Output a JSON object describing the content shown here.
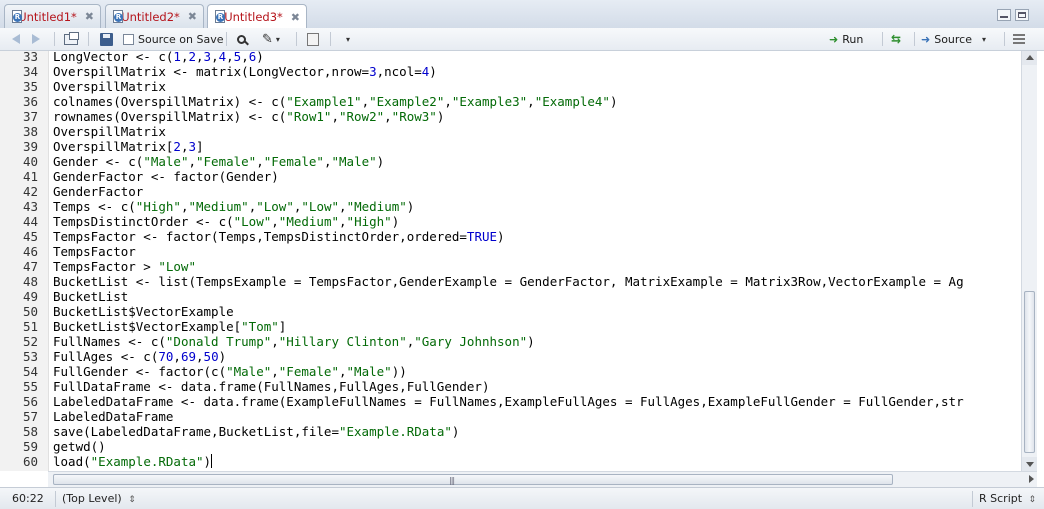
{
  "tabs": [
    {
      "label": "Untitled1*",
      "active": false
    },
    {
      "label": "Untitled2*",
      "active": false
    },
    {
      "label": "Untitled3*",
      "active": true
    }
  ],
  "toolbar": {
    "source_on_save_label": "Source on Save",
    "run_label": "Run",
    "source_label": "Source"
  },
  "code_lines": [
    {
      "n": "33",
      "text": "LongVector <- c(1,2,3,4,5,6)"
    },
    {
      "n": "34",
      "text": "OverspillMatrix <- matrix(LongVector,nrow=3,ncol=4)"
    },
    {
      "n": "35",
      "text": "OverspillMatrix"
    },
    {
      "n": "36",
      "text": "colnames(OverspillMatrix) <- c(\"Example1\",\"Example2\",\"Example3\",\"Example4\")"
    },
    {
      "n": "37",
      "text": "rownames(OverspillMatrix) <- c(\"Row1\",\"Row2\",\"Row3\")"
    },
    {
      "n": "38",
      "text": "OverspillMatrix"
    },
    {
      "n": "39",
      "text": "OverspillMatrix[2,3]"
    },
    {
      "n": "40",
      "text": "Gender <- c(\"Male\",\"Female\",\"Female\",\"Male\")"
    },
    {
      "n": "41",
      "text": "GenderFactor <- factor(Gender)"
    },
    {
      "n": "42",
      "text": "GenderFactor"
    },
    {
      "n": "43",
      "text": "Temps <- c(\"High\",\"Medium\",\"Low\",\"Low\",\"Medium\")"
    },
    {
      "n": "44",
      "text": "TempsDistinctOrder <- c(\"Low\",\"Medium\",\"High\")"
    },
    {
      "n": "45",
      "text": "TempsFactor <- factor(Temps,TempsDistinctOrder,ordered=TRUE)"
    },
    {
      "n": "46",
      "text": "TempsFactor"
    },
    {
      "n": "47",
      "text": "TempsFactor > \"Low\""
    },
    {
      "n": "48",
      "text": "BucketList <- list(TempsExample = TempsFactor,GenderExample = GenderFactor, MatrixExample = Matrix3Row,VectorExample = Ag"
    },
    {
      "n": "49",
      "text": "BucketList"
    },
    {
      "n": "50",
      "text": "BucketList$VectorExample"
    },
    {
      "n": "51",
      "text": "BucketList$VectorExample[\"Tom\"]"
    },
    {
      "n": "52",
      "text": "FullNames <- c(\"Donald Trump\",\"Hillary Clinton\",\"Gary Johnhson\")"
    },
    {
      "n": "53",
      "text": "FullAges <- c(70,69,50)"
    },
    {
      "n": "54",
      "text": "FullGender <- factor(c(\"Male\",\"Female\",\"Male\"))"
    },
    {
      "n": "55",
      "text": "FullDataFrame <- data.frame(FullNames,FullAges,FullGender)"
    },
    {
      "n": "56",
      "text": "LabeledDataFrame <- data.frame(ExampleFullNames = FullNames,ExampleFullAges = FullAges,ExampleFullGender = FullGender,str"
    },
    {
      "n": "57",
      "text": "LabeledDataFrame"
    },
    {
      "n": "58",
      "text": "save(LabeledDataFrame,BucketList,file=\"Example.RData\")"
    },
    {
      "n": "59",
      "text": "getwd()"
    },
    {
      "n": "60",
      "text": "load(\"Example.RData\")"
    }
  ],
  "status": {
    "position": "60:22",
    "scope": "(Top Level)",
    "file_type": "R Script"
  },
  "colors": {
    "tab_text": "#b5141b",
    "string": "#036a07",
    "number": "#0000cd",
    "keyword": "#0000cd"
  }
}
